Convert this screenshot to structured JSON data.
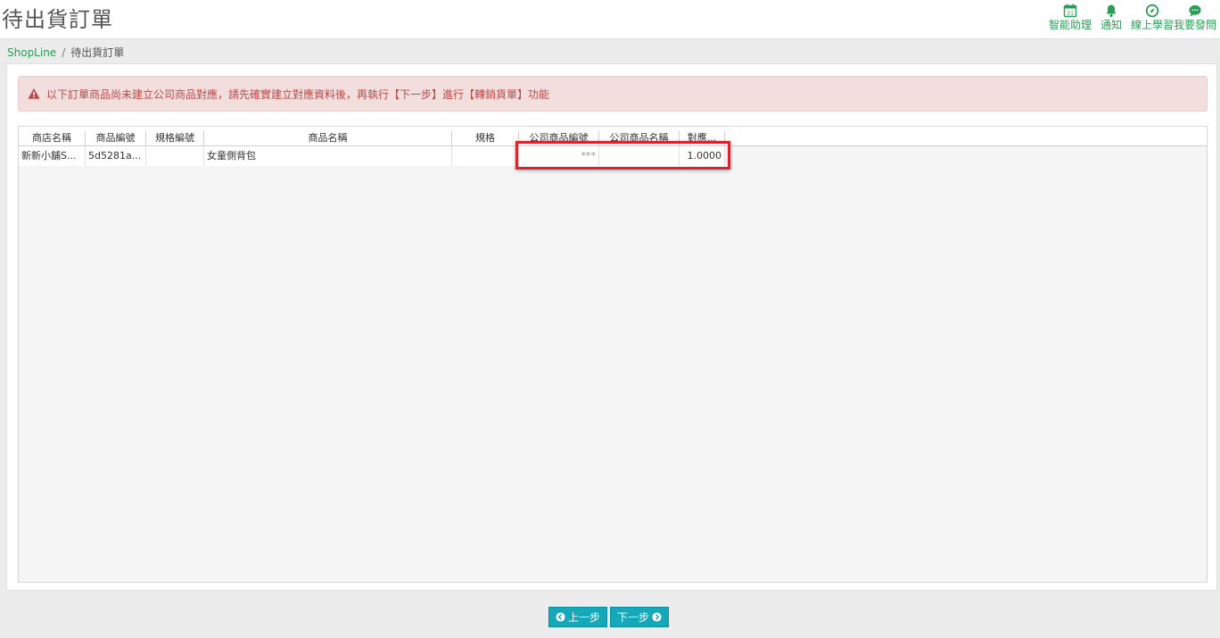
{
  "header": {
    "title": "待出貨訂單"
  },
  "tools": [
    {
      "label": "智能助理",
      "icon": "calendar-icon",
      "day": "31"
    },
    {
      "label": "通知",
      "icon": "bell-icon"
    },
    {
      "label": "線上學習",
      "icon": "compass-icon"
    },
    {
      "label": "我要發問",
      "icon": "chat-icon"
    }
  ],
  "breadcrumb": {
    "root": "ShopLine",
    "separator": "/",
    "current": "待出貨訂單"
  },
  "alert": {
    "message": "以下訂單商品尚未建立公司商品對應，請先確實建立對應資料後，再執行【下一步】進行【轉銷貨單】功能"
  },
  "table": {
    "columns": [
      "商店名稱",
      "商品編號",
      "規格編號",
      "商品名稱",
      "規格",
      "公司商品編號",
      "公司商品名稱",
      "對應..."
    ],
    "rows": [
      [
        "新新小舖S...",
        "5d5281a...",
        "",
        "女童側背包",
        "",
        "***",
        "",
        "1.0000"
      ]
    ]
  },
  "buttons": {
    "prev": "上一步",
    "next": "下一步"
  },
  "colors": {
    "accent": "#2b9c55",
    "button": "#14a8b9",
    "alert_text": "#b94a48",
    "alert_bg": "#f3dede",
    "highlight": "#d9242b"
  }
}
